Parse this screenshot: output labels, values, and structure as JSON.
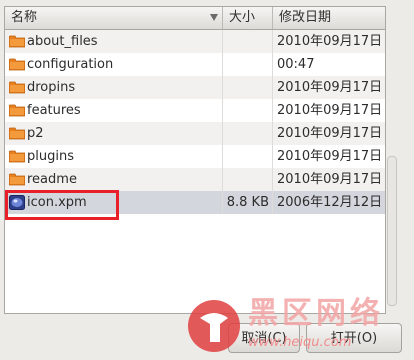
{
  "columns": {
    "name": "名称",
    "size": "大小",
    "modified": "修改日期"
  },
  "files": [
    {
      "name": "about_files",
      "size": "",
      "modified": "2010年09月17日",
      "type": "folder",
      "icon": "folder-icon"
    },
    {
      "name": "configuration",
      "size": "",
      "modified": "00:47",
      "type": "folder",
      "icon": "folder-icon"
    },
    {
      "name": "dropins",
      "size": "",
      "modified": "2010年09月17日",
      "type": "folder",
      "icon": "folder-icon"
    },
    {
      "name": "features",
      "size": "",
      "modified": "2010年09月17日",
      "type": "folder",
      "icon": "folder-icon"
    },
    {
      "name": "p2",
      "size": "",
      "modified": "2010年09月17日",
      "type": "folder",
      "icon": "folder-icon"
    },
    {
      "name": "plugins",
      "size": "",
      "modified": "2010年09月17日",
      "type": "folder",
      "icon": "folder-icon"
    },
    {
      "name": "readme",
      "size": "",
      "modified": "2010年09月17日",
      "type": "folder",
      "icon": "folder-icon"
    },
    {
      "name": "icon.xpm",
      "size": "8.8 KB",
      "modified": "2006年12月12日",
      "type": "image-file",
      "icon": "image-file-icon"
    }
  ],
  "buttons": {
    "cancel": "取消(C)",
    "open": "打开(O)"
  },
  "watermark": {
    "title": "黑区网络",
    "url": "www.heiqu.com"
  },
  "colors": {
    "highlight": "#e8202a",
    "folder": "#e8801e",
    "selected_row": "#d3d6dc"
  }
}
